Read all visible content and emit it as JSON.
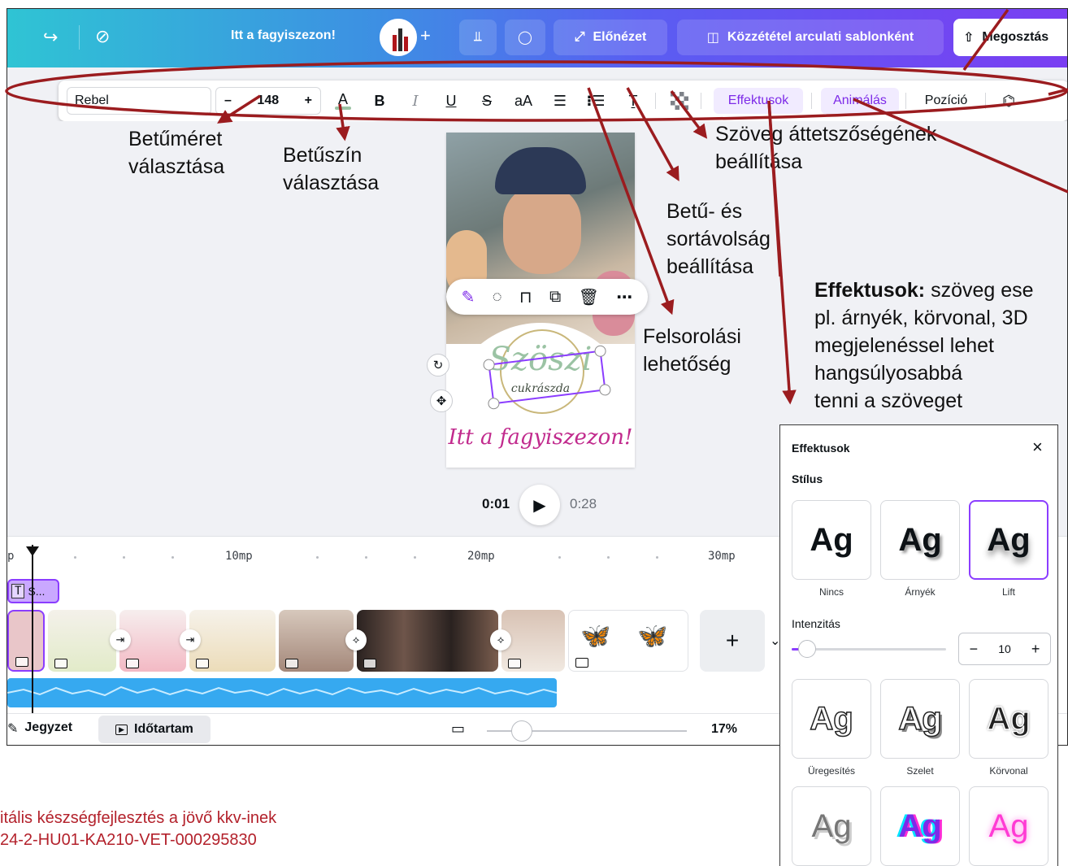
{
  "topbar": {
    "title": "Itt a fagyiszezon!",
    "preview_label": "Előnézet",
    "publish_label": "Közzététel arculati sablonként",
    "share_label": "Megosztás"
  },
  "text_toolbar": {
    "font": "Rebel",
    "font_size": "148",
    "minus": "–",
    "plus": "+",
    "case": "aA",
    "effects_label": "Effektusok",
    "animate_label": "Animálás",
    "position_label": "Pozíció"
  },
  "design": {
    "logo_script": "Szöszi",
    "logo_sub": "cukrászda",
    "caption": "Itt a fagyiszezon!"
  },
  "playback": {
    "current": "0:01",
    "total": "0:28"
  },
  "timeline": {
    "ruler": [
      "p",
      "10mp",
      "20mp",
      "30mp"
    ],
    "text_track_label": "S...",
    "text_track_icon": "T"
  },
  "bottombar": {
    "notes_label": "Jegyzet",
    "duration_label": "Időtartam",
    "zoom": "17%"
  },
  "effects_panel": {
    "title": "Effektusok",
    "style_heading": "Stílus",
    "tile_text": "Ag",
    "styles": [
      "Nincs",
      "Árnyék",
      "Lift",
      "Üregesítés",
      "Szelet",
      "Körvonal"
    ],
    "intensity_label": "Intenzitás",
    "intensity_value": "10",
    "intensity_level": 0.1
  },
  "annotations": {
    "font_size_l1": "Betűméret",
    "font_size_l2": "választása",
    "font_color_l1": "Betűszín",
    "font_color_l2": "választása",
    "transparency_l1": "Szöveg áttetszőségének",
    "transparency_l2": "beállítása",
    "spacing_l1": "Betű- és",
    "spacing_l2": "sortávolság",
    "spacing_l3": "beállítása",
    "list_l1": "Felsorolási",
    "list_l2": "lehetőség",
    "effects_bold": "Effektusok:",
    "effects_l1": " szöveg ese",
    "effects_l2": "pl. árnyék, körvonal, 3D",
    "effects_l3": "megjelenéssel lehet",
    "effects_l4": "hangsúlyosabbá",
    "effects_l5": "tenni a szöveget"
  },
  "footer": {
    "line1": "itális készségfejlesztés a jövő kkv-inek",
    "line2": "24-2-HU01-KA210-VET-000295830"
  },
  "colors": {
    "accent": "#8b3dff",
    "annotation_arrow": "#9b1c1f",
    "footer_text": "#b3212b",
    "audio_track": "#36a9f0"
  }
}
